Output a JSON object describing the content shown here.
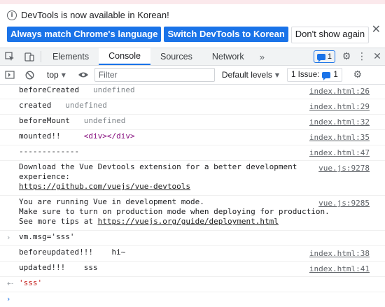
{
  "infobar": {
    "message": "DevTools is now available in Korean!",
    "buttons": [
      "Always match Chrome's language",
      "Switch DevTools to Korean",
      "Don't show again"
    ]
  },
  "tabs": [
    "Elements",
    "Console",
    "Sources",
    "Network"
  ],
  "issues_count": "1",
  "toolbar": {
    "context": "top",
    "filter_placeholder": "Filter",
    "levels": "Default levels",
    "issues_label": "1 Issue:",
    "issues_count": "1"
  },
  "console": [
    {
      "id": "m1",
      "text": "beforeCreated",
      "value": "undefined",
      "source": "index.html:26"
    },
    {
      "id": "m2",
      "text": "created",
      "value": "undefined",
      "source": "index.html:29"
    },
    {
      "id": "m3",
      "text": "beforeMount",
      "value": "undefined",
      "source": "index.html:32"
    },
    {
      "id": "m4",
      "text": "mounted!!",
      "value": "<div></div>",
      "source": "index.html:35"
    },
    {
      "id": "m5",
      "text": "-------------",
      "source": "index.html:47"
    },
    {
      "id": "m6",
      "line1": "Download the Vue Devtools extension for a better development",
      "line2": "experience:",
      "link": "https://github.com/vuejs/vue-devtools",
      "source": "vue.js:9278"
    },
    {
      "id": "m7",
      "line1": "You are running Vue in development mode.",
      "line2": "Make sure to turn on production mode when deploying for production.",
      "line3": "See more tips at ",
      "link": "https://vuejs.org/guide/deployment.html",
      "source": "vue.js:9285"
    },
    {
      "id": "m8",
      "command": "vm.msg='sss'"
    },
    {
      "id": "m9",
      "text": "beforeupdated!!!",
      "value": "hi~",
      "source": "index.html:38"
    },
    {
      "id": "m10",
      "text": "updated!!!",
      "value": "sss",
      "source": "index.html:41"
    },
    {
      "id": "m11",
      "result": "'sss'"
    }
  ]
}
